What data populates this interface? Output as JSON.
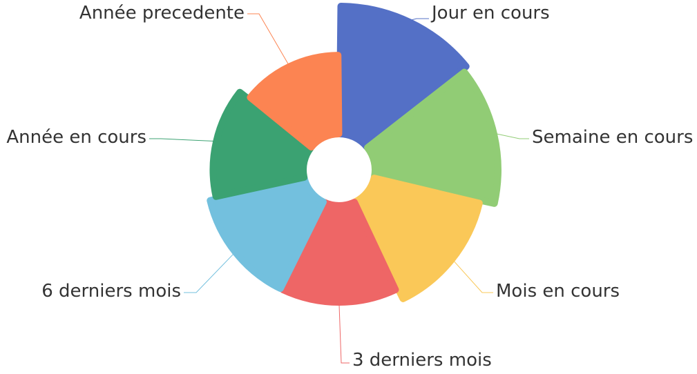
{
  "chart_data": {
    "type": "pie",
    "variant": "rose-radius",
    "categories": [
      "Jour en cours",
      "Semaine en cours",
      "Mois en cours",
      "3 derniers mois",
      "6 derniers mois",
      "Année en cours",
      "Année precedente"
    ],
    "values": [
      100,
      97,
      88,
      81,
      81,
      77,
      70
    ],
    "colors": [
      "#5470c6",
      "#91cc75",
      "#fac858",
      "#ee6666",
      "#73c0de",
      "#3ba272",
      "#fc8452"
    ],
    "title": "",
    "legend": "none"
  }
}
